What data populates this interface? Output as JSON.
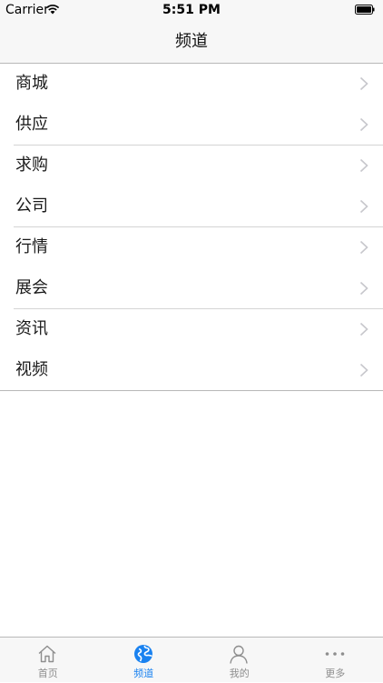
{
  "status_bar": {
    "carrier": "Carrier",
    "time": "5:51 PM",
    "wifi_icon": "wifi-icon",
    "battery_icon": "battery-icon"
  },
  "nav": {
    "title": "频道"
  },
  "channels": [
    {
      "label": "商城"
    },
    {
      "label": "供应"
    },
    {
      "label": "求购"
    },
    {
      "label": "公司"
    },
    {
      "label": "行情"
    },
    {
      "label": "展会"
    },
    {
      "label": "资讯"
    },
    {
      "label": "视频"
    }
  ],
  "tabs": [
    {
      "label": "首页",
      "icon": "home-icon",
      "active": false
    },
    {
      "label": "频道",
      "icon": "globe-icon",
      "active": true
    },
    {
      "label": "我的",
      "icon": "person-icon",
      "active": false
    },
    {
      "label": "更多",
      "icon": "more-dots-icon",
      "active": false
    }
  ],
  "colors": {
    "accent": "#1a82f0",
    "tab_inactive": "#8e8e8e",
    "bar_background": "#f7f7f7",
    "separator": "#d4d4d4",
    "chevron": "#c7c7cc"
  }
}
